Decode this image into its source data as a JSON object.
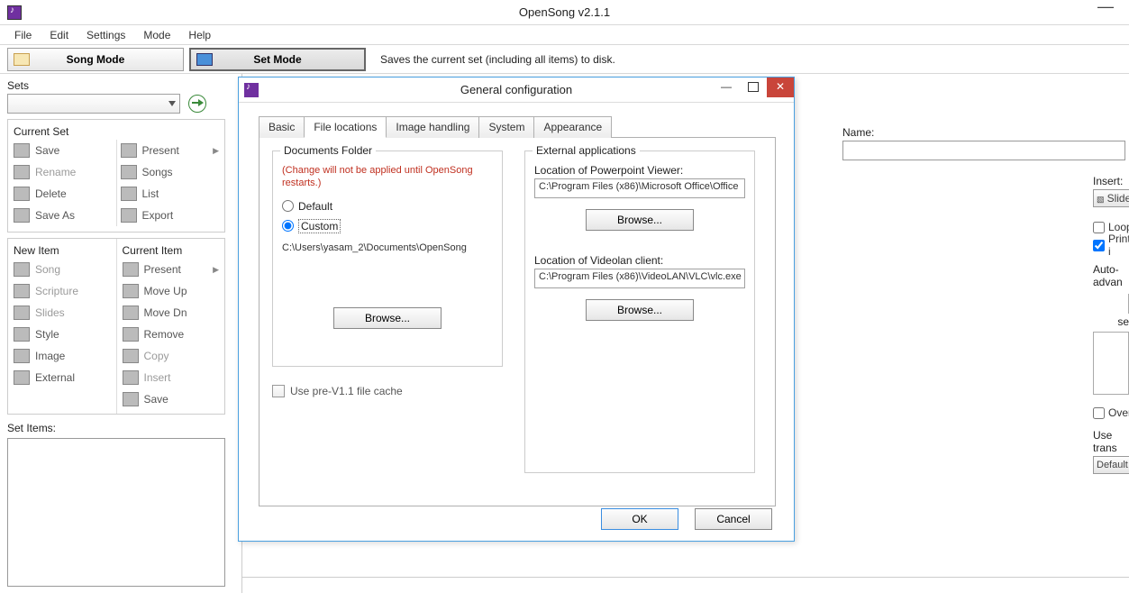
{
  "app": {
    "title": "OpenSong v2.1.1"
  },
  "menu": {
    "file": "File",
    "edit": "Edit",
    "settings": "Settings",
    "mode": "Mode",
    "help": "Help"
  },
  "toolbar": {
    "song_mode": "Song Mode",
    "set_mode": "Set Mode",
    "tooltip": "Saves the current set (including all items) to disk."
  },
  "sidebar": {
    "sets_label": "Sets",
    "current_set_label": "Current Set",
    "left_items": [
      "Save",
      "Rename",
      "Delete",
      "Save As"
    ],
    "right_items": [
      "Present",
      "Songs",
      "List",
      "Export"
    ],
    "new_item_label": "New Item",
    "new_items": [
      "Song",
      "Scripture",
      "Slides",
      "Style",
      "Image",
      "External"
    ],
    "current_item_label": "Current Item",
    "current_items": [
      "Present",
      "Move Up",
      "Move Dn",
      "Remove",
      "Copy",
      "Insert",
      "Save"
    ],
    "set_items_label": "Set Items:"
  },
  "right": {
    "name_label": "Name:",
    "insert_label": "Insert:",
    "slide_btn": "Slide",
    "loop_label": "Loop",
    "print_label": "Print i",
    "auto_adv": "Auto-advan",
    "sec_label": "se",
    "overr_label": "Overr",
    "use_trans": "Use trans",
    "default_btn": "Default"
  },
  "dialog": {
    "title": "General configuration",
    "tabs": [
      "Basic",
      "File locations",
      "Image handling",
      "System",
      "Appearance"
    ],
    "docs_folder": {
      "legend": "Documents Folder",
      "warning": "(Change will not be applied until OpenSong restarts.)",
      "default_label": "Default",
      "custom_label": "Custom",
      "path": "C:\\Users\\yasam_2\\Documents\\OpenSong",
      "browse": "Browse..."
    },
    "ext_apps": {
      "legend": "External applications",
      "ppt_label": "Location of Powerpoint Viewer:",
      "ppt_path": "C:\\Program Files (x86)\\Microsoft Office\\Office",
      "vlc_label": "Location of Videolan client:",
      "vlc_path": "C:\\Program Files (x86)\\VideoLAN\\VLC\\vlc.exe",
      "browse": "Browse..."
    },
    "cache_label": "Use pre-V1.1 file cache",
    "ok": "OK",
    "cancel": "Cancel"
  }
}
